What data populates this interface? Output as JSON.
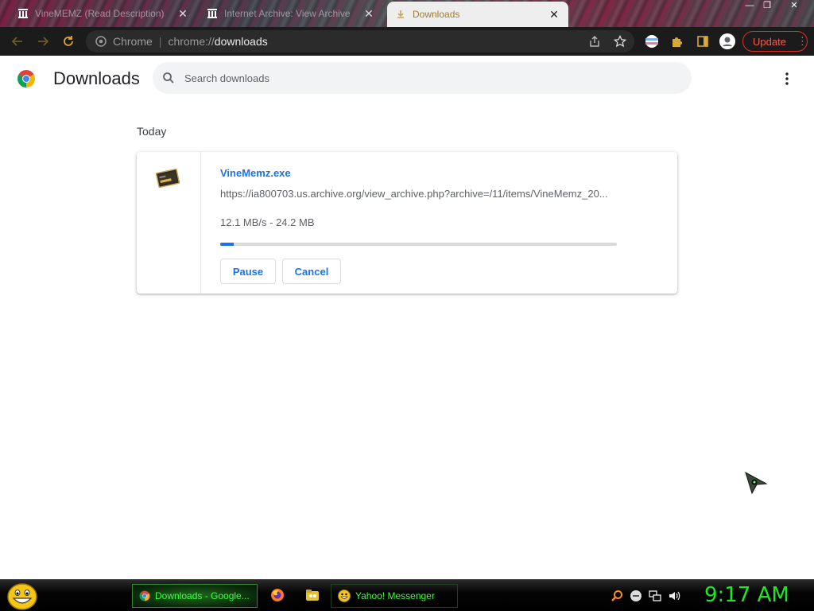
{
  "browser": {
    "tabs": [
      {
        "title": "VineMEMZ (Read Description)",
        "icon": "archive-icon"
      },
      {
        "title": "Internet Archive: View Archive",
        "icon": "archive-icon"
      },
      {
        "title": "Downloads",
        "icon": "download-icon",
        "active": true
      }
    ],
    "omnibox": {
      "scheme_label": "Chrome",
      "url_prefix": "chrome://",
      "url_host": "downloads"
    },
    "update_label": "Update"
  },
  "page": {
    "title": "Downloads",
    "search_placeholder": "Search downloads",
    "date_heading": "Today"
  },
  "download": {
    "file_name": "VineMemz.exe",
    "url": "https://ia800703.us.archive.org/view_archive.php?archive=/11/items/VineMemz_20...",
    "status": "12.1 MB/s - 24.2 MB",
    "progress_percent": 3.5,
    "pause_label": "Pause",
    "cancel_label": "Cancel"
  },
  "taskbar": {
    "items": [
      {
        "label": "Downloads - Google...",
        "icon": "chrome-icon",
        "active": true
      },
      {
        "label": "Yahoo! Messenger",
        "icon": "yahoo-messenger-icon",
        "active": false
      }
    ],
    "clock": "9:17 AM"
  },
  "colors": {
    "accent": "#1a73e8",
    "update_red": "#d93025",
    "taskbar_green": "#1ee81e"
  }
}
